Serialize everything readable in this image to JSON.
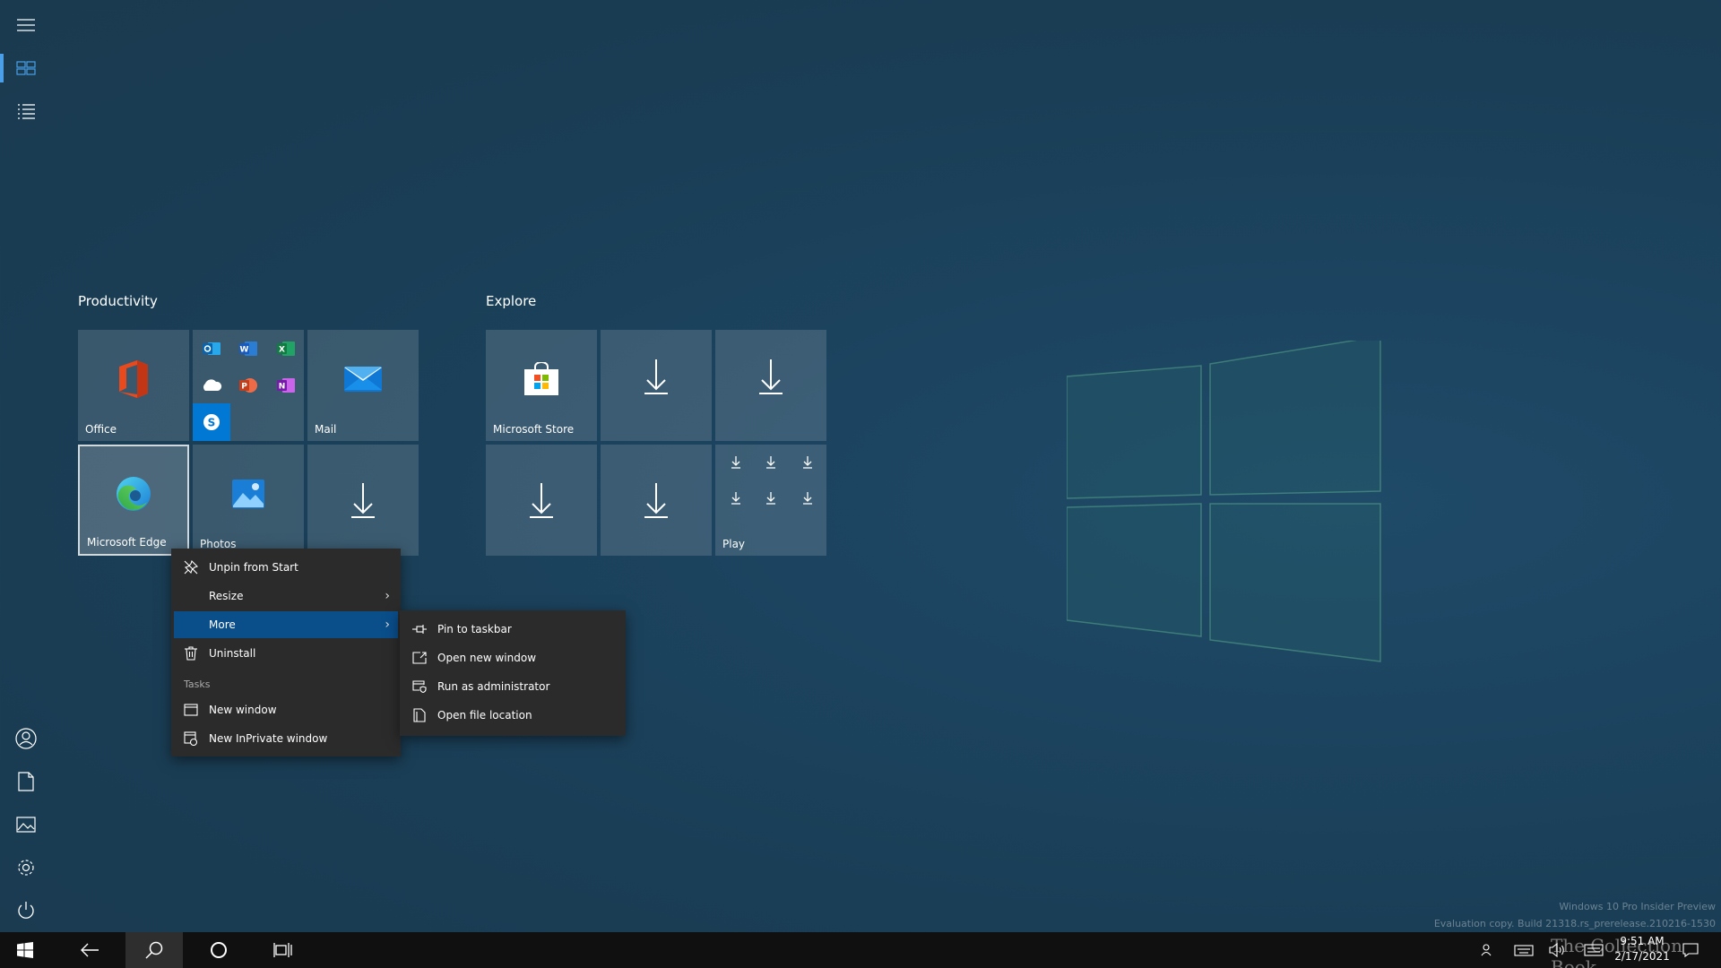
{
  "groups": {
    "productivity": "Productivity",
    "explore": "Explore"
  },
  "tiles": {
    "office": "Office",
    "mail": "Mail",
    "edge": "Microsoft Edge",
    "photos": "Photos",
    "store": "Microsoft Store",
    "play": "Play"
  },
  "context_menu": {
    "unpin": "Unpin from Start",
    "resize": "Resize",
    "more": "More",
    "uninstall": "Uninstall",
    "tasks_header": "Tasks",
    "new_window": "New window",
    "new_inprivate": "New InPrivate window"
  },
  "submenu": {
    "pin_taskbar": "Pin to taskbar",
    "open_new_window": "Open new window",
    "run_admin": "Run as administrator",
    "open_file_location": "Open file location"
  },
  "taskbar": {
    "time": "9:51 AM",
    "date": "2/17/2021"
  },
  "watermark": {
    "line1": "Windows 10 Pro Insider Preview",
    "line2": "Evaluation copy. Build 21318.rs_prerelease.210216-1530",
    "brand": "The Collection Book"
  },
  "colors": {
    "accent": "#0a4e8a",
    "rail_active": "#4a9fe8",
    "taskbar": "#101010",
    "menu": "#2b2b2b"
  }
}
